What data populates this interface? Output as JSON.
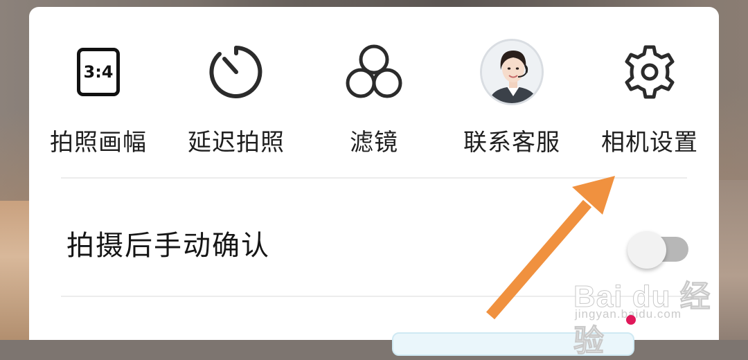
{
  "menu": {
    "items": [
      {
        "label": "拍照画幅",
        "icon": "aspect-ratio-icon",
        "badge": "3:4"
      },
      {
        "label": "延迟拍照",
        "icon": "timer-icon"
      },
      {
        "label": "滤镜",
        "icon": "filter-icon"
      },
      {
        "label": "联系客服",
        "icon": "customer-service-avatar-icon"
      },
      {
        "label": "相机设置",
        "icon": "gear-icon"
      }
    ]
  },
  "settings": {
    "manual_confirm_label": "拍摄后手动确认",
    "manual_confirm_enabled": false
  },
  "watermark": {
    "brand": "Bai du 经验",
    "url": "jingyan.baidu.com"
  },
  "colors": {
    "arrow": "#f0913f",
    "toggle_track": "#b7b7b7",
    "red_dot": "#e0185a"
  }
}
